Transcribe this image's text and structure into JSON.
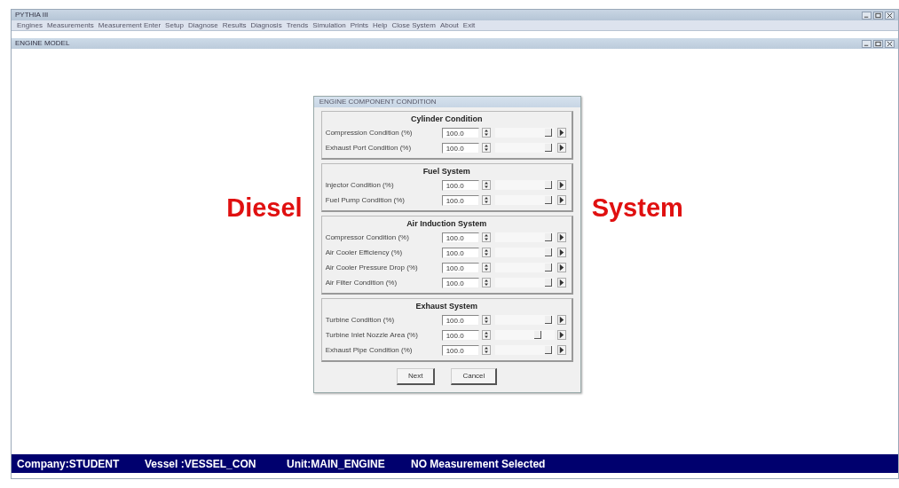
{
  "window": {
    "title": "PYTHIA III"
  },
  "menu": [
    "Engines",
    "Measurements",
    "Measurement Enter",
    "Setup",
    "Diagnose",
    "Results",
    "Diagnosis",
    "Trends",
    "Simulation",
    "Prints",
    "Help",
    "Close System",
    "About",
    "Exit"
  ],
  "child_window": {
    "title": "ENGINE MODEL"
  },
  "overlay_words": [
    "Diesel",
    "System"
  ],
  "dialog": {
    "title": "ENGINE COMPONENT CONDITION",
    "groups": [
      {
        "title": "Cylinder Condition",
        "rows": [
          {
            "label": "Compression Condition (%)",
            "value": "100.0",
            "level": 0.95
          },
          {
            "label": "Exhaust Port Condition (%)",
            "value": "100.0",
            "level": 0.95
          }
        ]
      },
      {
        "title": "Fuel System",
        "rows": [
          {
            "label": "Injector Condition (%)",
            "value": "100.0",
            "level": 0.95
          },
          {
            "label": "Fuel Pump Condition (%)",
            "value": "100.0",
            "level": 0.95
          }
        ]
      },
      {
        "title": "Air Induction System",
        "rows": [
          {
            "label": "Compressor Condition (%)",
            "value": "100.0",
            "level": 0.95
          },
          {
            "label": "Air Cooler Efficiency (%)",
            "value": "100.0",
            "level": 0.95
          },
          {
            "label": "Air Cooler Pressure Drop (%)",
            "value": "100.0",
            "level": 0.95
          },
          {
            "label": "Air Filter Condition (%)",
            "value": "100.0",
            "level": 0.95
          }
        ]
      },
      {
        "title": "Exhaust System",
        "rows": [
          {
            "label": "Turbine Condition (%)",
            "value": "100.0",
            "level": 0.95
          },
          {
            "label": "Turbine Inlet Nozzle Area (%)",
            "value": "100.0",
            "level": 0.75
          },
          {
            "label": "Exhaust Pipe Condition (%)",
            "value": "100.0",
            "level": 0.95
          }
        ]
      }
    ],
    "buttons": [
      "Next",
      "Cancel"
    ]
  },
  "status_bar": [
    "Company:STUDENT",
    "Vessel :VESSEL_CON",
    "Unit:MAIN_ENGINE",
    "NO Measurement Selected"
  ]
}
